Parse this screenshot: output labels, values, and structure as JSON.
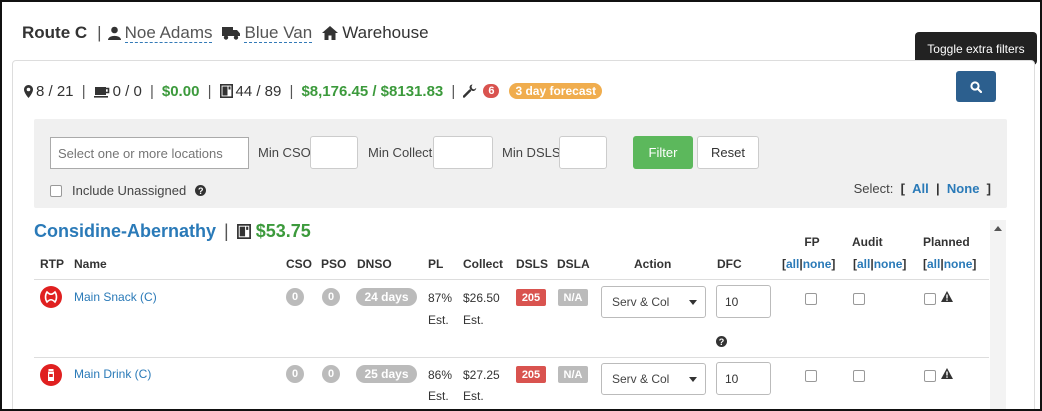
{
  "header": {
    "route": "Route C",
    "driver": "Noe Adams",
    "vehicle": "Blue Van",
    "location": "Warehouse"
  },
  "tooltip": "Toggle extra filters",
  "stats": {
    "locations": "8 / 21",
    "cups": "0 / 0",
    "cups_amount": "$0.00",
    "machines": "44 / 89",
    "amounts": "$8,176.45 / $8131.83",
    "repairs": "6",
    "forecast": "3 day forecast"
  },
  "filters": {
    "locations_placeholder": "Select one or more locations",
    "min_cso": "Min CSO",
    "min_collect": "Min Collect",
    "min_dsls": "Min DSLS",
    "filter_button": "Filter",
    "reset_button": "Reset",
    "include_unassigned": "Include Unassigned",
    "select_label": "Select:",
    "select_all": "All",
    "select_none": "None"
  },
  "group": {
    "name": "Considine-Abernathy",
    "amount": "$53.75"
  },
  "columns": {
    "rtp": "RTP",
    "name": "Name",
    "cso": "CSO",
    "pso": "PSO",
    "dnso": "DNSO",
    "pl": "PL",
    "collect": "Collect",
    "dsls": "DSLS",
    "dsla": "DSLA",
    "action": "Action",
    "dfc": "DFC",
    "fp": "FP",
    "audit": "Audit",
    "planned": "Planned",
    "all": "all",
    "none": "none"
  },
  "rows": [
    {
      "icon": "snack-icon",
      "name": "Main Snack (C)",
      "cso": "0",
      "pso": "0",
      "dnso": "24 days",
      "pl": "87%",
      "pl_est": "Est.",
      "collect": "$26.50",
      "collect_est": "Est.",
      "dsls": "205",
      "dsla": "N/A",
      "action": "Serv & Col",
      "dfc": "10"
    },
    {
      "icon": "drink-icon",
      "name": "Main Drink (C)",
      "cso": "0",
      "pso": "0",
      "dnso": "25 days",
      "pl": "86%",
      "pl_est": "Est.",
      "collect": "$27.25",
      "collect_est": "Est.",
      "dsls": "205",
      "dsla": "N/A",
      "action": "Serv & Col",
      "dfc": "10"
    }
  ]
}
